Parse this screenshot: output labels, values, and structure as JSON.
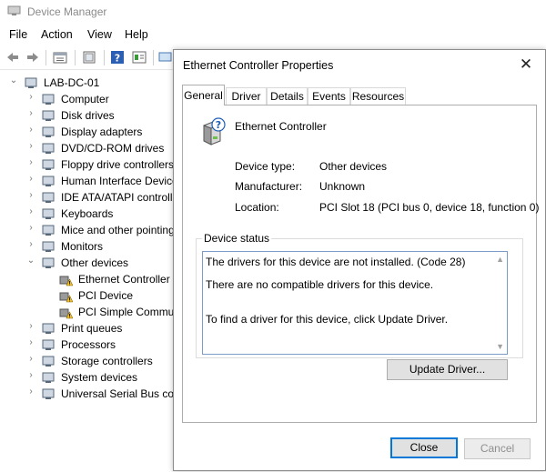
{
  "device_manager": {
    "title": "Device Manager",
    "menu": [
      "File",
      "Action",
      "View",
      "Help"
    ],
    "tree": {
      "root": "LAB-DC-01",
      "items": [
        {
          "label": "Computer",
          "icon": "computer-icon"
        },
        {
          "label": "Disk drives",
          "icon": "disk-drive-icon"
        },
        {
          "label": "Display adapters",
          "icon": "display-adapter-icon"
        },
        {
          "label": "DVD/CD-ROM drives",
          "icon": "dvd-drive-icon"
        },
        {
          "label": "Floppy drive controllers",
          "icon": "floppy-controller-icon"
        },
        {
          "label": "Human Interface Device",
          "icon": "hid-icon"
        },
        {
          "label": "IDE ATA/ATAPI controlle",
          "icon": "ide-controller-icon"
        },
        {
          "label": "Keyboards",
          "icon": "keyboard-icon"
        },
        {
          "label": "Mice and other pointing",
          "icon": "mouse-icon"
        },
        {
          "label": "Monitors",
          "icon": "monitor-icon"
        },
        {
          "label": "Other devices",
          "icon": "other-devices-icon",
          "expanded": true,
          "children": [
            {
              "label": "Ethernet Controller",
              "icon": "warning-device-icon"
            },
            {
              "label": "PCI Device",
              "icon": "warning-device-icon"
            },
            {
              "label": "PCI Simple Commun",
              "icon": "warning-device-icon"
            }
          ]
        },
        {
          "label": "Print queues",
          "icon": "printer-icon"
        },
        {
          "label": "Processors",
          "icon": "processor-icon"
        },
        {
          "label": "Storage controllers",
          "icon": "storage-controller-icon"
        },
        {
          "label": "System devices",
          "icon": "system-devices-icon"
        },
        {
          "label": "Universal Serial Bus cont",
          "icon": "usb-icon"
        }
      ]
    }
  },
  "dialog": {
    "title": "Ethernet Controller Properties",
    "tabs": [
      "General",
      "Driver",
      "Details",
      "Events",
      "Resources"
    ],
    "active_tab": "General",
    "device_name": "Ethernet Controller",
    "properties": [
      {
        "label": "Device type:",
        "value": "Other devices"
      },
      {
        "label": "Manufacturer:",
        "value": "Unknown"
      },
      {
        "label": "Location:",
        "value": "PCI Slot 18 (PCI bus 0, device 18, function 0)"
      }
    ],
    "device_status": {
      "title": "Device status",
      "lines": [
        "The drivers for this device are not installed. (Code 28)",
        "There are no compatible drivers for this device.",
        "To find a driver for this device, click Update Driver."
      ]
    },
    "update_driver_label": "Update Driver...",
    "close_label": "Close",
    "cancel_label": "Cancel"
  }
}
